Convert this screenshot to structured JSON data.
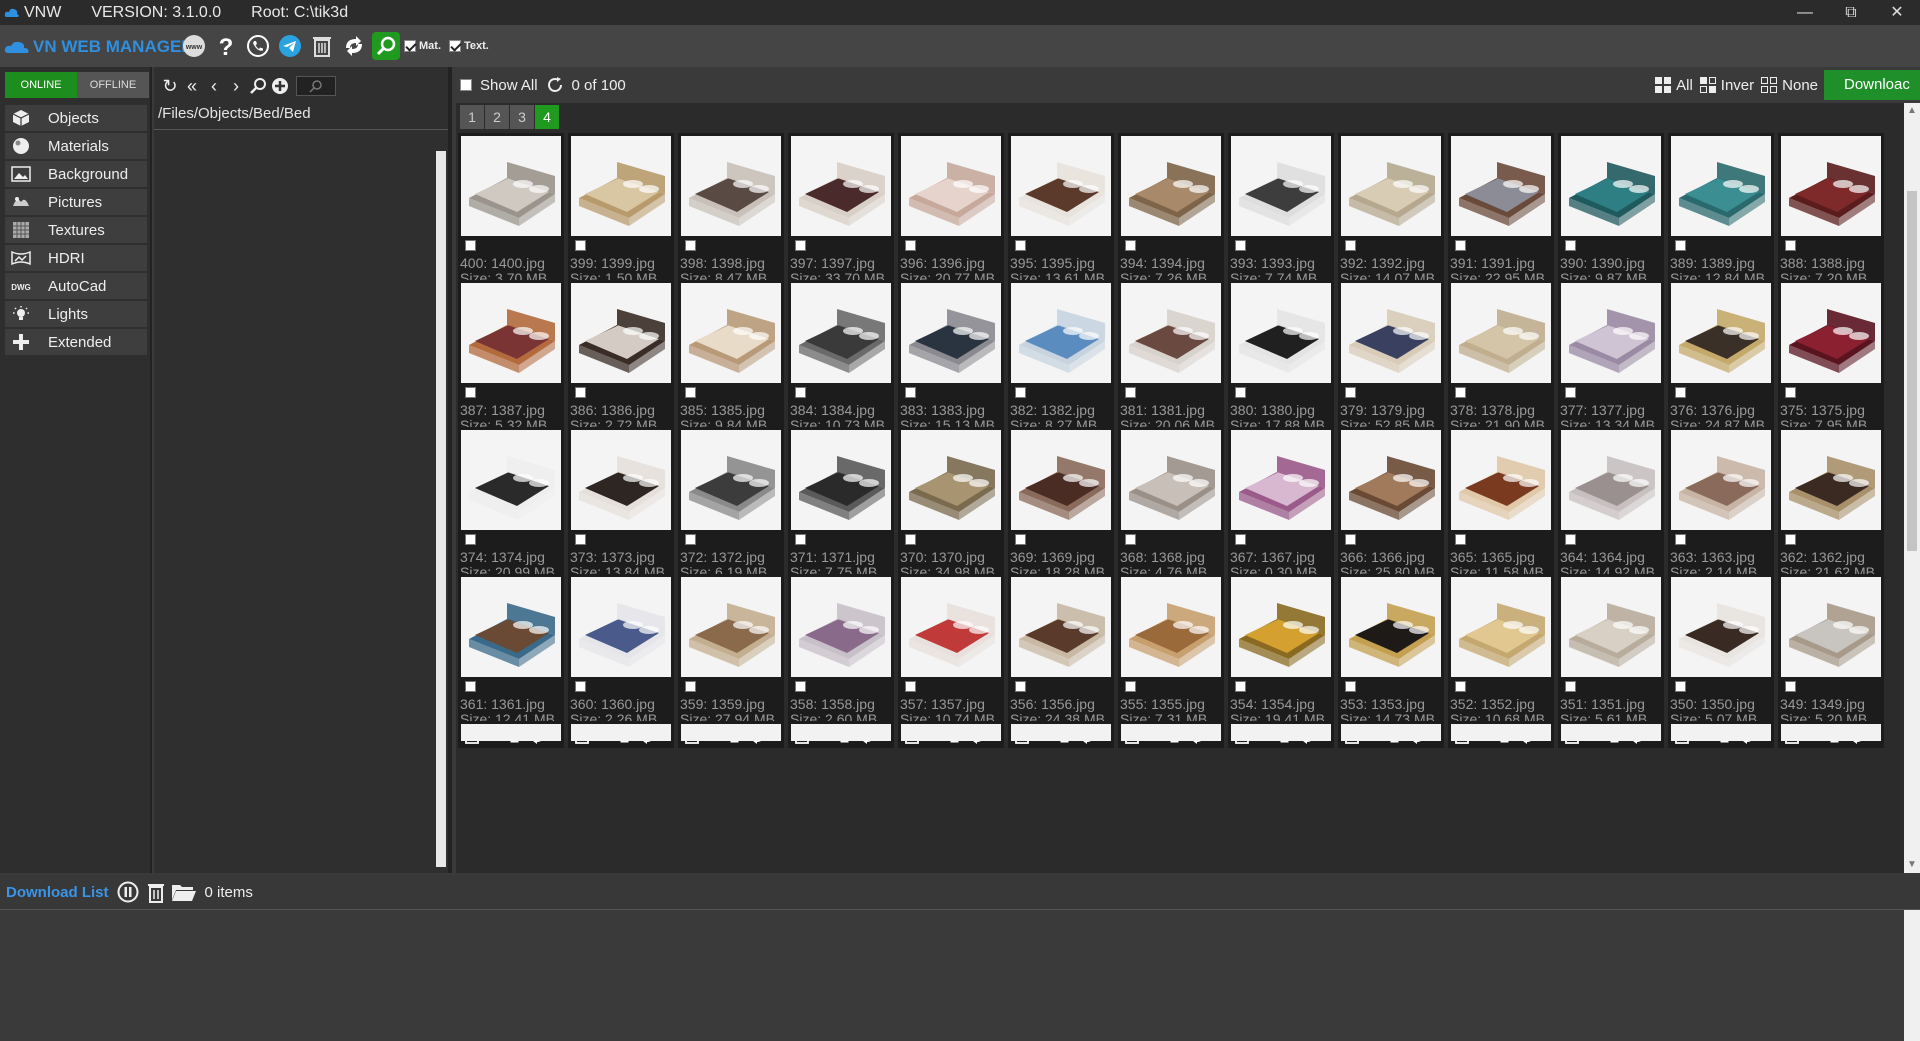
{
  "titlebar": {
    "app_name": "VNW",
    "version": "VERSION: 3.1.0.0",
    "root": "Root: C:\\tik3d",
    "minimize_icon": "minimize-icon",
    "restore_icon": "restore-icon",
    "close_icon": "close-icon"
  },
  "toolbar": {
    "brand": "VN WEB MANAGER",
    "mat_label": "Mat.",
    "text_label": "Text."
  },
  "mode": {
    "online": "ONLINE",
    "offline": "OFFLINE"
  },
  "categories": [
    {
      "label": "Objects",
      "icon": "cube-icon"
    },
    {
      "label": "Materials",
      "icon": "sphere-icon"
    },
    {
      "label": "Background",
      "icon": "image-icon"
    },
    {
      "label": "Pictures",
      "icon": "pictures-icon"
    },
    {
      "label": "Textures",
      "icon": "texture-icon"
    },
    {
      "label": "HDRI",
      "icon": "hdri-icon"
    },
    {
      "label": "AutoCad",
      "icon": "dwg-icon"
    },
    {
      "label": "Lights",
      "icon": "bulb-icon"
    },
    {
      "label": "Extended",
      "icon": "plus-icon"
    }
  ],
  "path": {
    "current": "/Files/Objects/Bed/Bed"
  },
  "main": {
    "show_all": "Show All",
    "count": "0 of 100",
    "select_all": "All",
    "invert": "Inver",
    "none": "None",
    "download": "Downloac",
    "pages": [
      "1",
      "2",
      "3",
      "4"
    ],
    "active_page": "4"
  },
  "tiles": [
    {
      "name": "400: 1400.jpg",
      "size": "Size: 3.70 MB",
      "color": "#cfc9c2",
      "accent": "#9a948c"
    },
    {
      "name": "399: 1399.jpg",
      "size": "Size: 1.50 MB",
      "color": "#d9c7a4",
      "accent": "#b89b6c"
    },
    {
      "name": "398: 1398.jpg",
      "size": "Size: 8.47 MB",
      "color": "#5a4a44",
      "accent": "#c9c1b9"
    },
    {
      "name": "397: 1397.jpg",
      "size": "Size: 33.70 MB",
      "color": "#4a2a2a",
      "accent": "#d8cfc6"
    },
    {
      "name": "396: 1396.jpg",
      "size": "Size: 20.77 MB",
      "color": "#e6d4cc",
      "accent": "#c7a99c"
    },
    {
      "name": "395: 1395.jpg",
      "size": "Size: 13.61 MB",
      "color": "#5b3a2c",
      "accent": "#e8e3dc"
    },
    {
      "name": "394: 1394.jpg",
      "size": "Size: 7.26 MB",
      "color": "#a88a6a",
      "accent": "#7e6448"
    },
    {
      "name": "393: 1393.jpg",
      "size": "Size: 7.74 MB",
      "color": "#3d3d3d",
      "accent": "#dedede"
    },
    {
      "name": "392: 1392.jpg",
      "size": "Size: 14.07 MB",
      "color": "#d8ccb4",
      "accent": "#b5a88e"
    },
    {
      "name": "391: 1391.jpg",
      "size": "Size: 22.95 MB",
      "color": "#8c8c96",
      "accent": "#6a4a3a"
    },
    {
      "name": "390: 1390.jpg",
      "size": "Size: 9.87 MB",
      "color": "#2e7f84",
      "accent": "#1f5a5e"
    },
    {
      "name": "389: 1389.jpg",
      "size": "Size: 12.84 MB",
      "color": "#3b8e92",
      "accent": "#2a6a6e"
    },
    {
      "name": "388: 1388.jpg",
      "size": "Size: 7.20 MB",
      "color": "#7e2a2a",
      "accent": "#5a1c1c"
    },
    {
      "name": "387: 1387.jpg",
      "size": "Size: 5.32 MB",
      "color": "#7a3434",
      "accent": "#b36a3c"
    },
    {
      "name": "386: 1386.jpg",
      "size": "Size: 2.72 MB",
      "color": "#d4ccc4",
      "accent": "#3a2c26"
    },
    {
      "name": "385: 1385.jpg",
      "size": "Size: 9.84 MB",
      "color": "#e8dcc8",
      "accent": "#b89a78"
    },
    {
      "name": "384: 1384.jpg",
      "size": "Size: 10.73 MB",
      "color": "#3a3a3a",
      "accent": "#6a6a6a"
    },
    {
      "name": "383: 1383.jpg",
      "size": "Size: 15.13 MB",
      "color": "#2a3440",
      "accent": "#8a8a90"
    },
    {
      "name": "382: 1382.jpg",
      "size": "Size: 8.27 MB",
      "color": "#5a8cc0",
      "accent": "#c7d4e0"
    },
    {
      "name": "381: 1381.jpg",
      "size": "Size: 20.06 MB",
      "color": "#6a4a40",
      "accent": "#d8d2cc"
    },
    {
      "name": "380: 1380.jpg",
      "size": "Size: 17.88 MB",
      "color": "#202020",
      "accent": "#e4e4e4"
    },
    {
      "name": "379: 1379.jpg",
      "size": "Size: 52.85 MB",
      "color": "#3a4060",
      "accent": "#d8ccb8"
    },
    {
      "name": "378: 1378.jpg",
      "size": "Size: 21.90 MB",
      "color": "#d4c4a8",
      "accent": "#c0ae8e"
    },
    {
      "name": "377: 1377.jpg",
      "size": "Size: 13.34 MB",
      "color": "#cfc4d4",
      "accent": "#9a8aa4"
    },
    {
      "name": "376: 1376.jpg",
      "size": "Size: 24.87 MB",
      "color": "#3a3028",
      "accent": "#c4aa6a"
    },
    {
      "name": "375: 1375.jpg",
      "size": "Size: 7.95 MB",
      "color": "#8a2030",
      "accent": "#5a1420"
    },
    {
      "name": "374: 1374.jpg",
      "size": "Size: 20.99 MB",
      "color": "#2a2a2a",
      "accent": "#eeeeee"
    },
    {
      "name": "373: 1373.jpg",
      "size": "Size: 13.84 MB",
      "color": "#2e2622",
      "accent": "#e6e0da"
    },
    {
      "name": "372: 1372.jpg",
      "size": "Size: 6.19 MB",
      "color": "#3c3c3c",
      "accent": "#8a8a8a"
    },
    {
      "name": "371: 1371.jpg",
      "size": "Size: 7.75 MB",
      "color": "#2a2a2a",
      "accent": "#5a5a5a"
    },
    {
      "name": "370: 1370.jpg",
      "size": "Size: 34.98 MB",
      "color": "#a89470",
      "accent": "#7a6a4e"
    },
    {
      "name": "369: 1369.jpg",
      "size": "Size: 18.28 MB",
      "color": "#4a2c24",
      "accent": "#8a6a5a"
    },
    {
      "name": "368: 1368.jpg",
      "size": "Size: 4.76 MB",
      "color": "#c8c0b8",
      "accent": "#9a9088"
    },
    {
      "name": "367: 1367.jpg",
      "size": "Size: 0.30 MB",
      "color": "#d8b8d0",
      "accent": "#9a5a8a"
    },
    {
      "name": "366: 1366.jpg",
      "size": "Size: 25.80 MB",
      "color": "#a07a5a",
      "accent": "#6a4a34"
    },
    {
      "name": "365: 1365.jpg",
      "size": "Size: 11.58 MB",
      "color": "#7a3a20",
      "accent": "#e0c8a8"
    },
    {
      "name": "364: 1364.jpg",
      "size": "Size: 14.92 MB",
      "color": "#9a9090",
      "accent": "#c8c0c0"
    },
    {
      "name": "363: 1363.jpg",
      "size": "Size: 2.14 MB",
      "color": "#8a6a5a",
      "accent": "#c8b4a4"
    },
    {
      "name": "362: 1362.jpg",
      "size": "Size: 21.62 MB",
      "color": "#3a2a22",
      "accent": "#a8906a"
    },
    {
      "name": "361: 1361.jpg",
      "size": "Size: 12.41 MB",
      "color": "#6a4a34",
      "accent": "#3a6a8a"
    },
    {
      "name": "360: 1360.jpg",
      "size": "Size: 2.26 MB",
      "color": "#4a5a8a",
      "accent": "#e6e6ea"
    },
    {
      "name": "359: 1359.jpg",
      "size": "Size: 27.94 MB",
      "color": "#8a6a4a",
      "accent": "#c4ae90"
    },
    {
      "name": "358: 1358.jpg",
      "size": "Size: 2.60 MB",
      "color": "#8a6a8a",
      "accent": "#c8c0c8"
    },
    {
      "name": "357: 1357.jpg",
      "size": "Size: 10.74 MB",
      "color": "#c03a3a",
      "accent": "#e8e0dc"
    },
    {
      "name": "356: 1356.jpg",
      "size": "Size: 24.38 MB",
      "color": "#5a3a2a",
      "accent": "#c8b8a4"
    },
    {
      "name": "355: 1355.jpg",
      "size": "Size: 7.31 MB",
      "color": "#9a6a3a",
      "accent": "#c8a070"
    },
    {
      "name": "354: 1354.jpg",
      "size": "Size: 19.41 MB",
      "color": "#d4a030",
      "accent": "#8a6a20"
    },
    {
      "name": "353: 1353.jpg",
      "size": "Size: 14.73 MB",
      "color": "#1e1a18",
      "accent": "#c4a050"
    },
    {
      "name": "352: 1352.jpg",
      "size": "Size: 10.68 MB",
      "color": "#e0c890",
      "accent": "#c4a870"
    },
    {
      "name": "351: 1351.jpg",
      "size": "Size: 5.61 MB",
      "color": "#d8d0c4",
      "accent": "#b8ac9c"
    },
    {
      "name": "350: 1350.jpg",
      "size": "Size: 5.07 MB",
      "color": "#3a2a24",
      "accent": "#e8e4e0"
    },
    {
      "name": "349: 1349.jpg",
      "size": "Size: 5.20 MB",
      "color": "#c8c4c0",
      "accent": "#a89a8a"
    }
  ],
  "download_list": {
    "title": "Download List",
    "items": "0 items"
  }
}
